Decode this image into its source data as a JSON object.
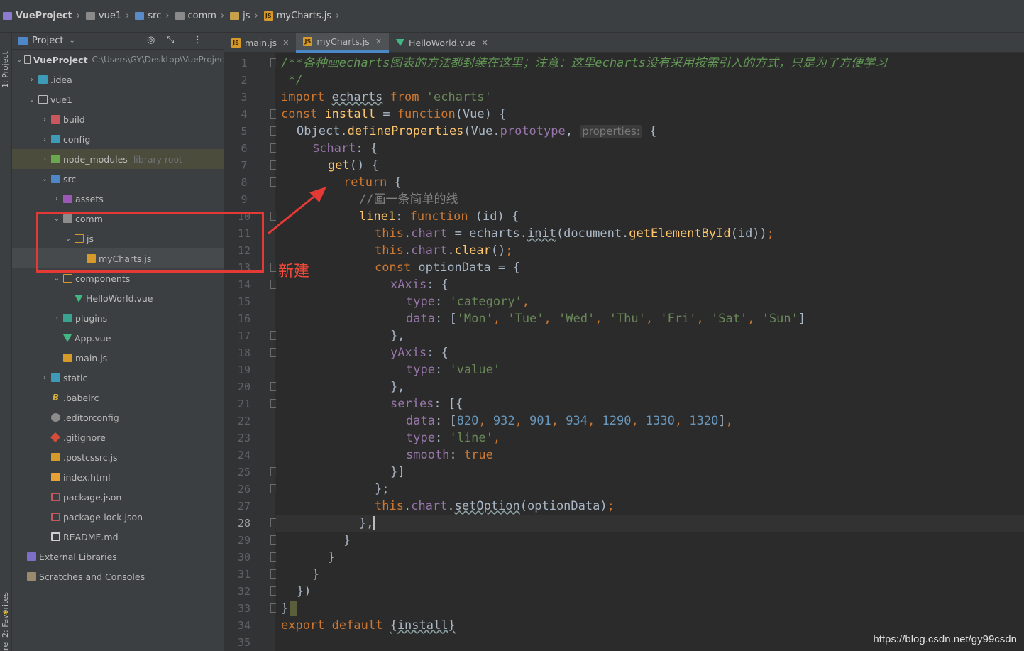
{
  "breadcrumb": {
    "project": "VueProject",
    "items": [
      "vue1",
      "src",
      "comm",
      "js",
      "myCharts.js"
    ]
  },
  "left_strip": {
    "project_tab": "1: Project",
    "favorites_tab": "2: Favorites",
    "structure_tab": "Structure"
  },
  "project_panel": {
    "header_label": "Project",
    "root_name": "VueProject",
    "root_path": "C:\\Users\\GY\\Desktop\\VueProjec",
    "items": [
      {
        "label": ".idea"
      },
      {
        "label": "vue1"
      },
      {
        "label": "build"
      },
      {
        "label": "config"
      },
      {
        "label": "node_modules",
        "note": "library root"
      },
      {
        "label": "src"
      },
      {
        "label": "assets"
      },
      {
        "label": "comm"
      },
      {
        "label": "js"
      },
      {
        "label": "myCharts.js"
      },
      {
        "label": "components"
      },
      {
        "label": "HelloWorld.vue"
      },
      {
        "label": "plugins"
      },
      {
        "label": "App.vue"
      },
      {
        "label": "main.js"
      },
      {
        "label": "static"
      },
      {
        "label": ".babelrc"
      },
      {
        "label": ".editorconfig"
      },
      {
        "label": ".gitignore"
      },
      {
        "label": ".postcssrc.js"
      },
      {
        "label": "index.html"
      },
      {
        "label": "package.json"
      },
      {
        "label": "package-lock.json"
      },
      {
        "label": "README.md"
      },
      {
        "label": "External Libraries"
      },
      {
        "label": "Scratches and Consoles"
      }
    ]
  },
  "tabs": [
    {
      "label": "main.js",
      "icon": "js-file-icon"
    },
    {
      "label": "myCharts.js",
      "icon": "js-file-icon",
      "active": true
    },
    {
      "label": "HelloWorld.vue",
      "icon": "vue-file-icon"
    }
  ],
  "editor": {
    "current_line": 28,
    "line_numbers": [
      "1",
      "2",
      "3",
      "4",
      "5",
      "6",
      "7",
      "8",
      "9",
      "10",
      "11",
      "12",
      "13",
      "14",
      "15",
      "16",
      "17",
      "18",
      "19",
      "20",
      "21",
      "22",
      "23",
      "24",
      "25",
      "26",
      "27",
      "28",
      "29",
      "30",
      "31",
      "32",
      "33",
      "34",
      "35"
    ],
    "lines": {
      "l1": "/**各种画echarts图表的方法都封装在这里；注意：这里echarts没有采用按需引入的方式，只是为了方便学习",
      "l2": " */",
      "l3_kw1": "import",
      "l3_id": "echarts",
      "l3_kw2": "from",
      "l3_str": "'echarts'",
      "l4_kw1": "const",
      "l4_id": "install",
      "l4_eq": " = ",
      "l4_fn": "function",
      "l4_args": "(Vue) {",
      "l5_obj": "Object.",
      "l5_fn": "defineProperties",
      "l5_mid": "(Vue.",
      "l5_prop": "prototype",
      "l5_comma": ", ",
      "l5_hint": "properties:",
      "l5_end": " {",
      "l6_prop": "$chart",
      "l6_end": ": {",
      "l7_fn": "get",
      "l7_end": "() {",
      "l8_kw": "return",
      "l8_end": " {",
      "l9": "//画一条简单的线",
      "l10_fn": "line1",
      "l10_colon": ": ",
      "l10_kw": "function",
      "l10_end": " (id) {",
      "l11_this": "this",
      "l11_dot": ".",
      "l11_prop": "chart",
      "l11_eq": " = echarts.",
      "l11_fn": "init",
      "l11_mid": "(document.",
      "l11_fn2": "getElementById",
      "l11_end": "(id))",
      "l11_semi": ";",
      "l12_this": "this",
      "l12_prop": "chart",
      "l12_fn": "clear",
      "l12_end": "()",
      "l12_semi": ";",
      "l13_kw": "const",
      "l13_end": " optionData = {",
      "l14_prop": "xAxis",
      "l14_end": ": {",
      "l15_prop": "type",
      "l15_str": "'category'",
      "l16_prop": "data",
      "l16_a": "'Mon'",
      "l16_b": "'Tue'",
      "l16_c": "'Wed'",
      "l16_d": "'Thu'",
      "l16_e": "'Fri'",
      "l16_f": "'Sat'",
      "l16_g": "'Sun'",
      "l17": "},",
      "l18_prop": "yAxis",
      "l18_end": ": {",
      "l19_prop": "type",
      "l19_str": "'value'",
      "l20": "},",
      "l21_prop": "series",
      "l21_end": ": [{",
      "l22_prop": "data",
      "l22_n1": "820",
      "l22_n2": "932",
      "l22_n3": "901",
      "l22_n4": "934",
      "l22_n5": "1290",
      "l22_n6": "1330",
      "l22_n7": "1320",
      "l23_prop": "type",
      "l23_str": "'line'",
      "l24_prop": "smooth",
      "l24_kw": "true",
      "l25": "}]",
      "l26": "};",
      "l27_this": "this",
      "l27_prop": "chart",
      "l27_fn": "setOption",
      "l27_end": "(optionData)",
      "l27_semi": ";",
      "l28": "},",
      "l29": "}",
      "l30": "}",
      "l31": "}",
      "l32": "})",
      "l33": "}",
      "l34_kw1": "export",
      "l34_kw2": "default",
      "l34_end": "{install}"
    }
  },
  "annotation": {
    "text": "新建",
    "color": "#e53935"
  },
  "watermark": "https://blog.csdn.net/gy99csdn",
  "colors": {
    "keyword": "#cc7832",
    "string": "#6a8759",
    "number": "#6897bb",
    "function": "#ffc66d",
    "property": "#9876aa",
    "doc_comment": "#629755",
    "background": "#2b2b2b"
  }
}
